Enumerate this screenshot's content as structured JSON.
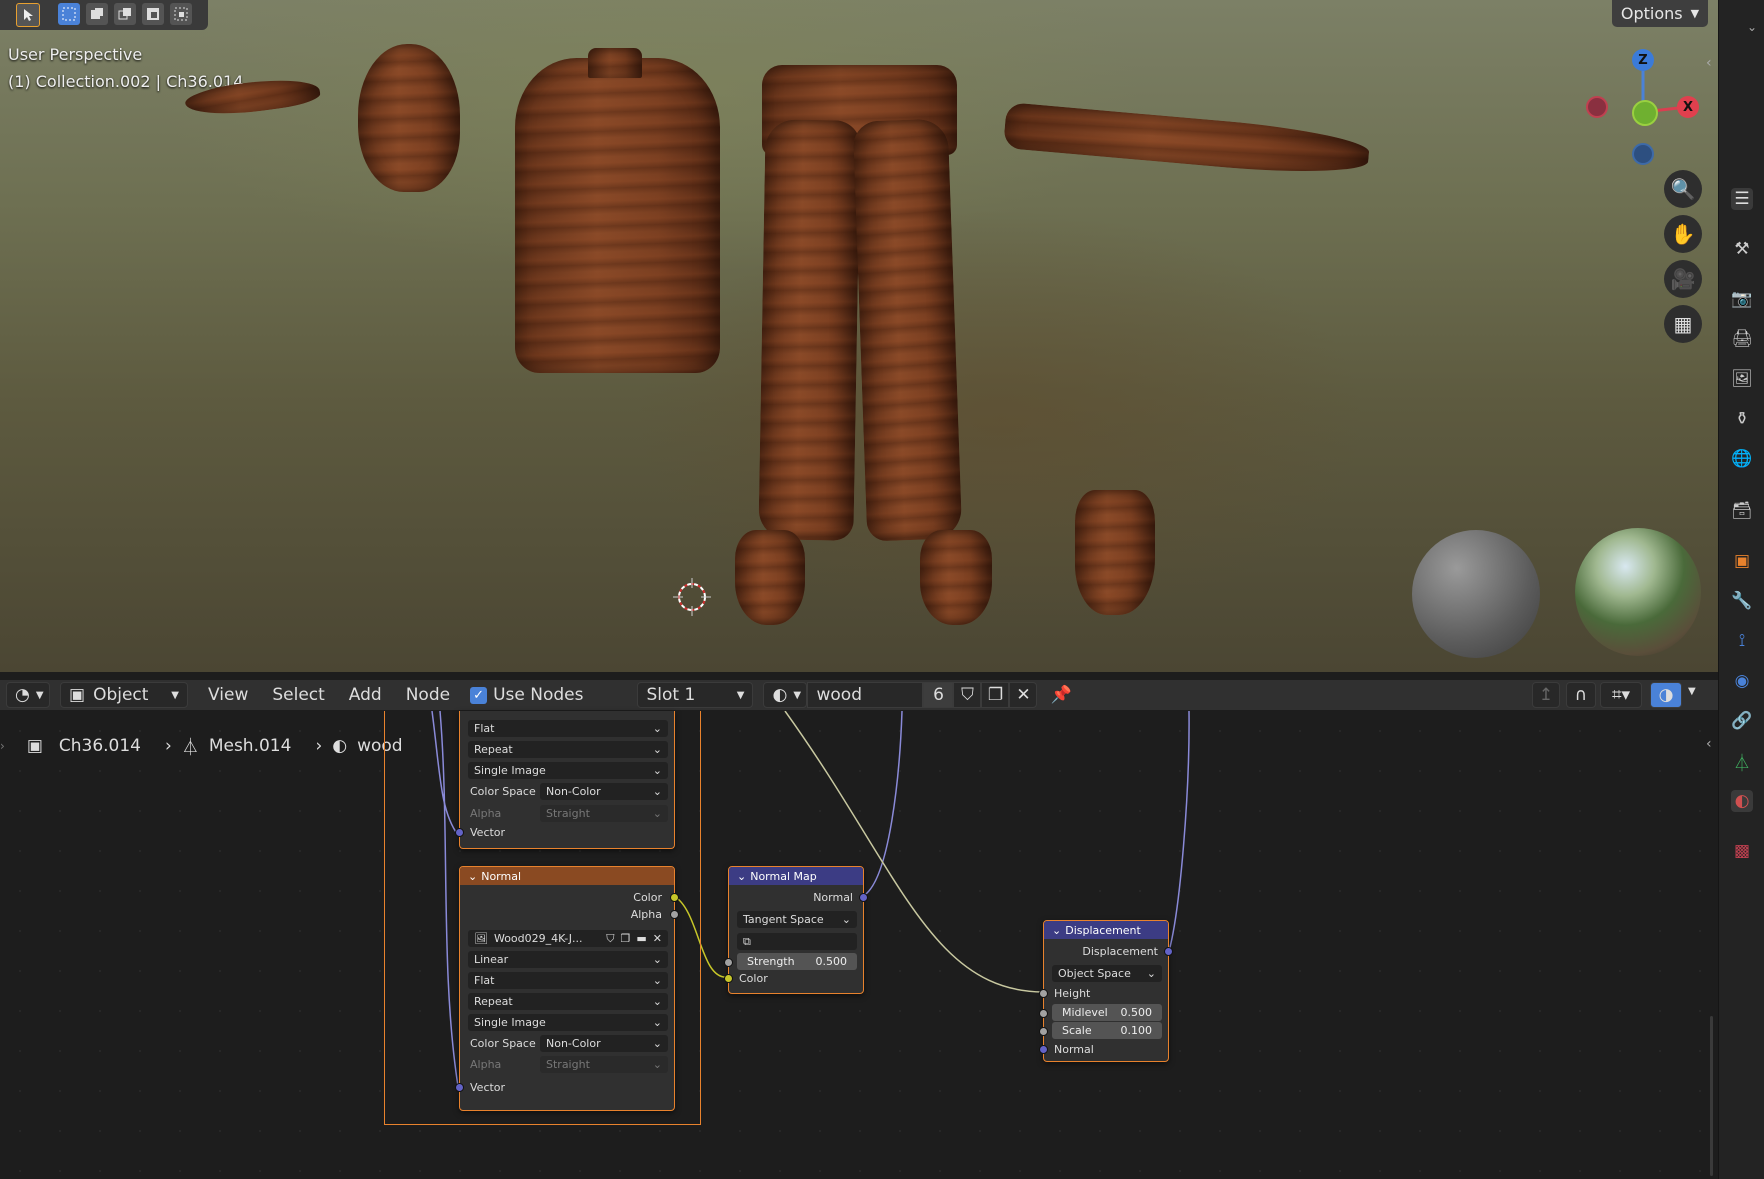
{
  "viewport": {
    "perspective_label": "User Perspective",
    "collection_label": "(1) Collection.002 | Ch36.014",
    "options_label": "Options",
    "gizmo": {
      "z": "Z",
      "x": "X"
    }
  },
  "node_header": {
    "editor_icon": "shader-editor-icon",
    "mode": "Object",
    "menus": [
      "View",
      "Select",
      "Add",
      "Node"
    ],
    "use_nodes_label": "Use Nodes",
    "use_nodes_checked": true,
    "slot": "Slot 1",
    "material_name": "wood",
    "user_count": "6"
  },
  "breadcrumb": {
    "object": "Ch36.014",
    "mesh": "Mesh.014",
    "material": "wood"
  },
  "nodes": {
    "upper_tex": {
      "extension_mode": "Flat",
      "repeat": "Repeat",
      "source": "Single Image",
      "color_space_label": "Color Space",
      "color_space": "Non-Color",
      "alpha_label": "Alpha",
      "alpha": "Straight",
      "vector_label": "Vector"
    },
    "normal_tex": {
      "title": "Normal",
      "out_color": "Color",
      "out_alpha": "Alpha",
      "image": "Wood029_4K-J...",
      "interpolation": "Linear",
      "projection": "Flat",
      "extension": "Repeat",
      "source": "Single Image",
      "color_space_label": "Color Space",
      "color_space": "Non-Color",
      "alpha_label": "Alpha",
      "alpha": "Straight",
      "vector_label": "Vector"
    },
    "normal_map": {
      "title": "Normal Map",
      "out_normal": "Normal",
      "space": "Tangent Space",
      "strength_label": "Strength",
      "strength": "0.500",
      "in_color": "Color"
    },
    "displacement": {
      "title": "Displacement",
      "out_displacement": "Displacement",
      "space": "Object Space",
      "in_height": "Height",
      "midlevel_label": "Midlevel",
      "midlevel": "0.500",
      "scale_label": "Scale",
      "scale": "0.100",
      "in_normal": "Normal"
    }
  },
  "colors": {
    "accent": "#4a82d8",
    "texture_header": "#8a4a22",
    "vector_header": "#3c3c84",
    "selected_outline": "#e8822d"
  }
}
